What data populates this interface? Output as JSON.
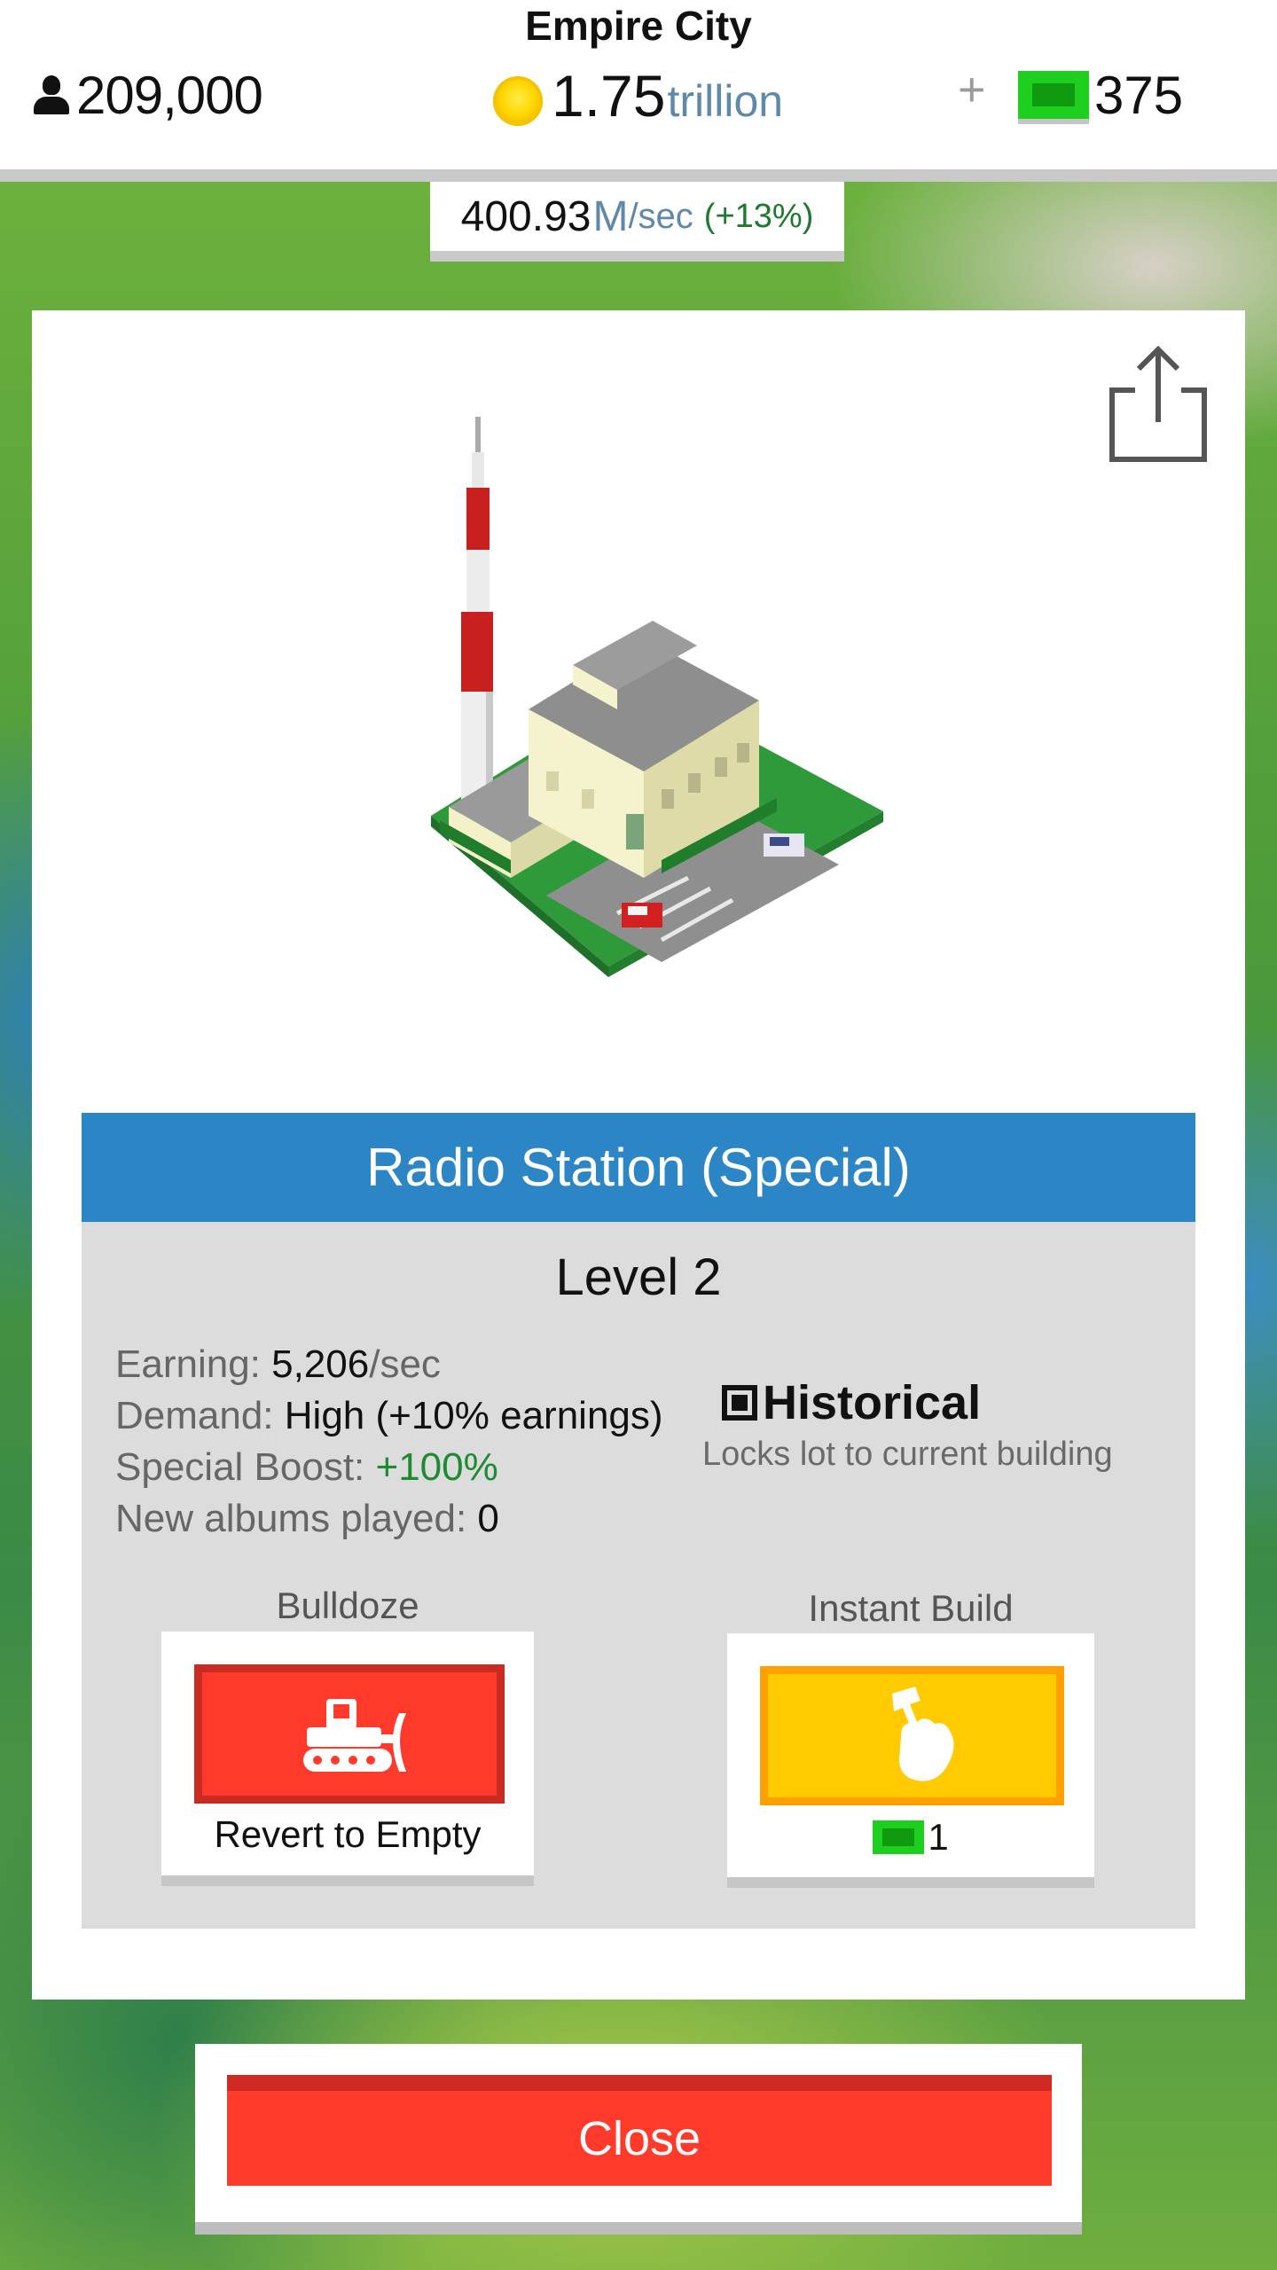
{
  "header": {
    "city_name": "Empire City",
    "population": "209,000",
    "money_value": "1.75",
    "money_unit": "trillion",
    "plus_label": "+",
    "cash_value": "375"
  },
  "income": {
    "value": "400.93",
    "unit": "M",
    "per": "/sec",
    "change": "(+13%)"
  },
  "building": {
    "name": "Radio Station (Special)",
    "level": "Level 2",
    "stats": [
      {
        "label": "Earning: ",
        "value": "5,206",
        "suffix": "/sec"
      },
      {
        "label": "Demand: ",
        "value": "High (+10% earnings)"
      },
      {
        "label": "Special Boost: ",
        "value": "+100%"
      },
      {
        "label": "New albums played: ",
        "value": "0"
      }
    ],
    "historical": {
      "checked": true,
      "label": "Historical",
      "description": "Locks lot to current building"
    }
  },
  "actions": {
    "bulldoze_label": "Bulldoze",
    "bulldoze_button_text": "Revert to Empty",
    "instant_label": "Instant Build",
    "instant_cost": "1"
  },
  "close_label": "Close",
  "colors": {
    "header_blue": "#2c85c5",
    "bulldoze_red": "#ff3a2a",
    "instant_yellow": "#ffcb00",
    "cash_green": "#1fcf1f",
    "boost_green": "#1e8a32",
    "unit_blue": "#5f89a6"
  }
}
